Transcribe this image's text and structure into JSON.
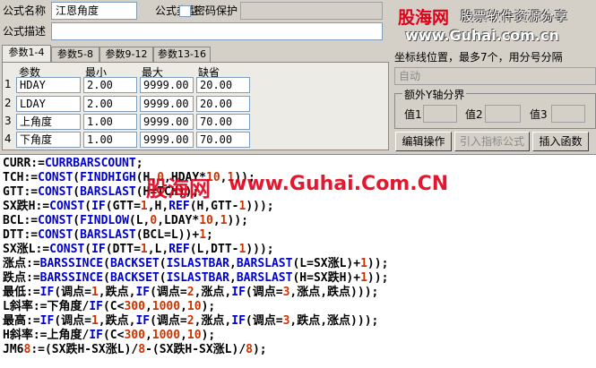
{
  "form": {
    "name_label": "公式名称",
    "name_value": "江恩角度",
    "password_label": "密码保护",
    "desc_label": "公式描述",
    "desc_value": ""
  },
  "banner": {
    "logo_text": "股海网",
    "slogan": "股票软件资源分享",
    "url": "www.Guhai.com.cn"
  },
  "tabs": [
    "参数1-4",
    "参数5-8",
    "参数9-12",
    "参数13-16"
  ],
  "params": {
    "headers": [
      "参数",
      "最小",
      "最大",
      "缺省"
    ],
    "rows": [
      {
        "num": "1",
        "name": "HDAY",
        "min": "2.00",
        "max": "9999.00",
        "def": "20.00"
      },
      {
        "num": "2",
        "name": "LDAY",
        "min": "2.00",
        "max": "9999.00",
        "def": "20.00"
      },
      {
        "num": "3",
        "name": "上角度",
        "min": "1.00",
        "max": "9999.00",
        "def": "70.00"
      },
      {
        "num": "4",
        "name": "下角度",
        "min": "1.00",
        "max": "9999.00",
        "def": "70.00"
      }
    ]
  },
  "axis": {
    "label": "坐标线位置，最多7个，用分号分隔",
    "value": "自动",
    "y_group_label": "额外Y轴分界",
    "v1": "值1",
    "v2": "值2",
    "v3": "值3"
  },
  "buttons": {
    "edit": "编辑操作",
    "import": "引入指标公式",
    "insert": "插入函数"
  },
  "watermark": {
    "logo": "股海网",
    "url": "www.Guhai.Com.CN"
  },
  "code_lines": [
    "CURR:=CURRBARSCOUNT;",
    "TCH:=CONST(FINDHIGH(H,0,HDAY*10,1));",
    "GTT:=CONST(BARSLAST(H=TCH));",
    "SX跌H:=CONST(IF(GTT=1,H,REF(H,GTT-1)));",
    "BCL:=CONST(FINDLOW(L,0,LDAY*10,1));",
    "DTT:=CONST(BARSLAST(BCL=L))+1;",
    "SX涨L:=CONST(IF(DTT=1,L,REF(L,DTT-1)));",
    "涨点:=BARSSINCE(BACKSET(ISLASTBAR,BARSLAST(L=SX涨L)+1));",
    "跌点:=BARSSINCE(BACKSET(ISLASTBAR,BARSLAST(H=SX跌H)+1));",
    "最低:=IF(调点=1,跌点,IF(调点=2,涨点,IF(调点=3,涨点,跌点)));",
    "L斜率:=下角度/IF(C<300,1000,10);",
    "最高:=IF(调点=1,跌点,IF(调点=2,涨点,IF(调点=3,跌点,涨点)));",
    "H斜率:=上角度/IF(C<300,1000,10);",
    "JM68:=(SX跌H-SX涨L)/8-(SX跌H-SX涨L)/8);"
  ],
  "colors": {
    "keyword": "#0000cc",
    "number": "#cc3300",
    "watermark_red": "#e0001a",
    "watermark_blue": "#1a3a9a"
  }
}
